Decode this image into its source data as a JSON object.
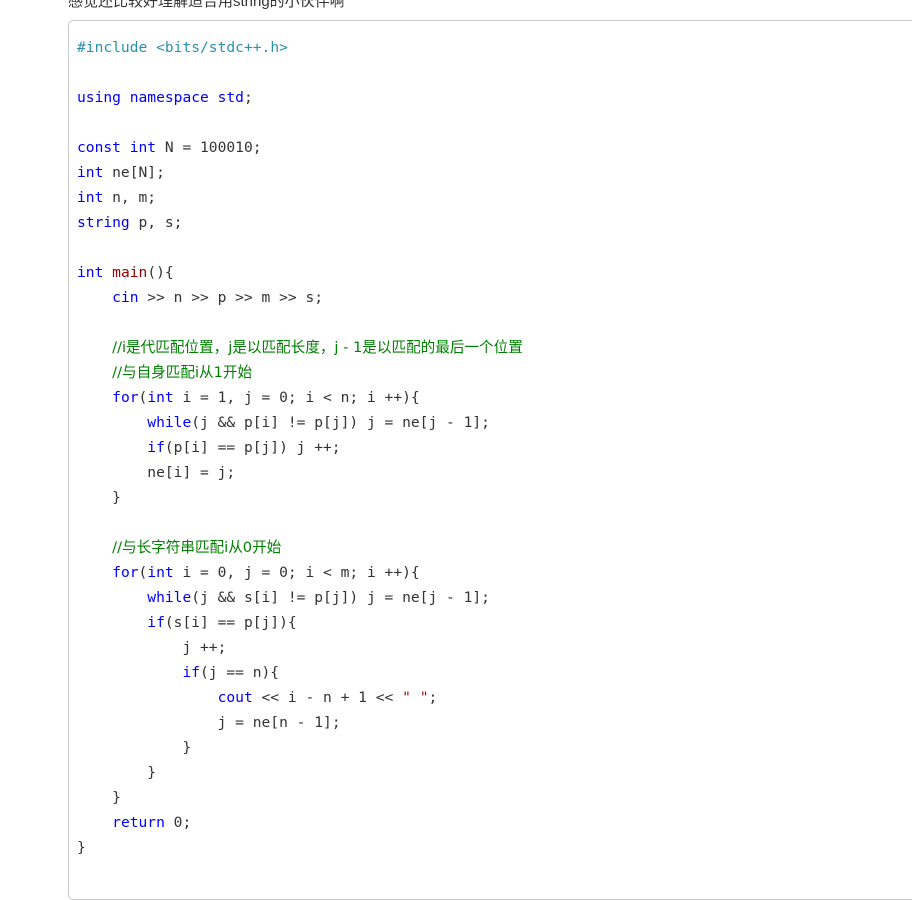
{
  "article": {
    "paragraph_clipped": "感觉还比较好理解适合用string的小伙伴啊"
  },
  "code_block": {
    "language": "cpp",
    "border_color": "#cccccc",
    "background_color": "#ffffff",
    "colors": {
      "preprocessor": "#2b91af",
      "keyword": "#0000ff",
      "function": "#990000",
      "string": "#a31515",
      "comment": "#008000",
      "plain": "#333333"
    },
    "lines": [
      {
        "id": "l1",
        "indent": 0,
        "tokens": [
          {
            "t": "#include",
            "c": "pre"
          },
          {
            "t": " ",
            "c": "plain"
          },
          {
            "t": "<bits/stdc++.h>",
            "c": "pre"
          }
        ]
      },
      {
        "id": "l2",
        "indent": 0,
        "tokens": []
      },
      {
        "id": "l3",
        "indent": 0,
        "tokens": [
          {
            "t": "using",
            "c": "kw"
          },
          {
            "t": " ",
            "c": "plain"
          },
          {
            "t": "namespace",
            "c": "kw"
          },
          {
            "t": " ",
            "c": "plain"
          },
          {
            "t": "std",
            "c": "kw"
          },
          {
            "t": ";",
            "c": "plain"
          }
        ]
      },
      {
        "id": "l4",
        "indent": 0,
        "tokens": []
      },
      {
        "id": "l5",
        "indent": 0,
        "tokens": [
          {
            "t": "const",
            "c": "kw"
          },
          {
            "t": " ",
            "c": "plain"
          },
          {
            "t": "int",
            "c": "kw"
          },
          {
            "t": " N = 100010;",
            "c": "plain"
          }
        ]
      },
      {
        "id": "l6",
        "indent": 0,
        "tokens": [
          {
            "t": "int",
            "c": "kw"
          },
          {
            "t": " ne[N];",
            "c": "plain"
          }
        ]
      },
      {
        "id": "l7",
        "indent": 0,
        "tokens": [
          {
            "t": "int",
            "c": "kw"
          },
          {
            "t": " n, m;",
            "c": "plain"
          }
        ]
      },
      {
        "id": "l8",
        "indent": 0,
        "tokens": [
          {
            "t": "string",
            "c": "kw"
          },
          {
            "t": " p, s;",
            "c": "plain"
          }
        ]
      },
      {
        "id": "l9",
        "indent": 0,
        "tokens": []
      },
      {
        "id": "l10",
        "indent": 0,
        "tokens": [
          {
            "t": "int",
            "c": "kw"
          },
          {
            "t": " ",
            "c": "plain"
          },
          {
            "t": "main",
            "c": "fn"
          },
          {
            "t": "(){",
            "c": "plain"
          }
        ]
      },
      {
        "id": "l11",
        "indent": 1,
        "tokens": [
          {
            "t": "cin",
            "c": "kw"
          },
          {
            "t": " >> n >> p >> m >> s;",
            "c": "plain"
          }
        ]
      },
      {
        "id": "l12",
        "indent": 0,
        "tokens": []
      },
      {
        "id": "l13",
        "indent": 1,
        "tokens": [
          {
            "t": "//i是代匹配位置，j是以匹配长度，j - 1是以匹配的最后一个位置",
            "c": "cmt"
          }
        ]
      },
      {
        "id": "l14",
        "indent": 1,
        "tokens": [
          {
            "t": "//与自身匹配i从1开始",
            "c": "cmt"
          }
        ]
      },
      {
        "id": "l15",
        "indent": 1,
        "tokens": [
          {
            "t": "for",
            "c": "kw"
          },
          {
            "t": "(",
            "c": "plain"
          },
          {
            "t": "int",
            "c": "kw"
          },
          {
            "t": " i = 1, j = 0; i < n; i ++){",
            "c": "plain"
          }
        ]
      },
      {
        "id": "l16",
        "indent": 2,
        "tokens": [
          {
            "t": "while",
            "c": "kw"
          },
          {
            "t": "(j && p[i] != p[j]) j = ne[j - 1];",
            "c": "plain"
          }
        ]
      },
      {
        "id": "l17",
        "indent": 2,
        "tokens": [
          {
            "t": "if",
            "c": "kw"
          },
          {
            "t": "(p[i] == p[j]) j ++;",
            "c": "plain"
          }
        ]
      },
      {
        "id": "l18",
        "indent": 2,
        "tokens": [
          {
            "t": "ne[i] = j;",
            "c": "plain"
          }
        ]
      },
      {
        "id": "l19",
        "indent": 1,
        "tokens": [
          {
            "t": "}",
            "c": "plain"
          }
        ]
      },
      {
        "id": "l20",
        "indent": 0,
        "tokens": []
      },
      {
        "id": "l21",
        "indent": 1,
        "tokens": [
          {
            "t": "//与长字符串匹配i从0开始",
            "c": "cmt"
          }
        ]
      },
      {
        "id": "l22",
        "indent": 1,
        "tokens": [
          {
            "t": "for",
            "c": "kw"
          },
          {
            "t": "(",
            "c": "plain"
          },
          {
            "t": "int",
            "c": "kw"
          },
          {
            "t": " i = 0, j = 0; i < m; i ++){",
            "c": "plain"
          }
        ]
      },
      {
        "id": "l23",
        "indent": 2,
        "tokens": [
          {
            "t": "while",
            "c": "kw"
          },
          {
            "t": "(j && s[i] != p[j]) j = ne[j - 1];",
            "c": "plain"
          }
        ]
      },
      {
        "id": "l24",
        "indent": 2,
        "tokens": [
          {
            "t": "if",
            "c": "kw"
          },
          {
            "t": "(s[i] == p[j]){",
            "c": "plain"
          }
        ]
      },
      {
        "id": "l25",
        "indent": 3,
        "tokens": [
          {
            "t": "j ++;",
            "c": "plain"
          }
        ]
      },
      {
        "id": "l26",
        "indent": 3,
        "tokens": [
          {
            "t": "if",
            "c": "kw"
          },
          {
            "t": "(j == n){",
            "c": "plain"
          }
        ]
      },
      {
        "id": "l27",
        "indent": 4,
        "tokens": [
          {
            "t": "cout",
            "c": "kw"
          },
          {
            "t": " << i - n + 1 << ",
            "c": "plain"
          },
          {
            "t": "\" \"",
            "c": "str"
          },
          {
            "t": ";",
            "c": "plain"
          }
        ]
      },
      {
        "id": "l28",
        "indent": 4,
        "tokens": [
          {
            "t": "j = ne[n - 1];",
            "c": "plain"
          }
        ]
      },
      {
        "id": "l29",
        "indent": 3,
        "tokens": [
          {
            "t": "}",
            "c": "plain"
          }
        ]
      },
      {
        "id": "l30",
        "indent": 2,
        "tokens": [
          {
            "t": "}",
            "c": "plain"
          }
        ]
      },
      {
        "id": "l31",
        "indent": 1,
        "tokens": [
          {
            "t": "}",
            "c": "plain"
          }
        ]
      },
      {
        "id": "l32",
        "indent": 1,
        "tokens": [
          {
            "t": "return",
            "c": "kw"
          },
          {
            "t": " 0;",
            "c": "plain"
          }
        ]
      },
      {
        "id": "l33",
        "indent": 0,
        "tokens": [
          {
            "t": "}",
            "c": "plain"
          }
        ]
      }
    ]
  }
}
